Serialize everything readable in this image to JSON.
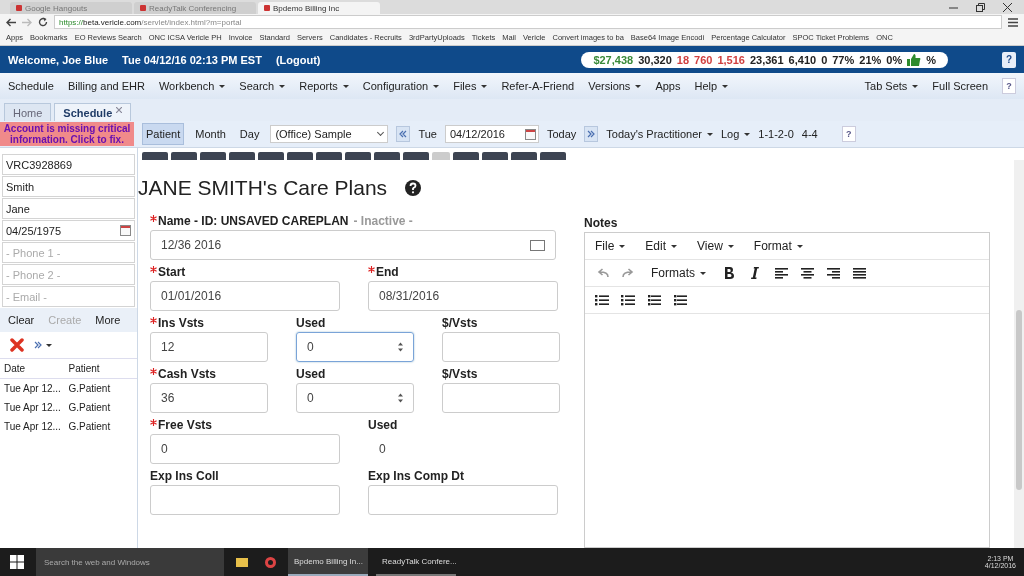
{
  "browser": {
    "tabs": [
      {
        "title": "Google Hangouts",
        "selected": false
      },
      {
        "title": "ReadyTalk Conferencing",
        "selected": false
      },
      {
        "title": "Bpdemo Billing Inc",
        "selected": true
      }
    ],
    "url_secure": "https://",
    "url_host": "beta.vericle.com",
    "url_path": "/servlet/index.html?m=portal",
    "bookmarks": [
      "Apps",
      "Bookmarks",
      "EO Reviews Search",
      "ONC ICSA Vericle PH",
      "Invoice",
      "Standard",
      "Servers",
      "Candidates - Recruits",
      "3rdPartyUploads",
      "Tickets",
      "Mail",
      "Vericle",
      "Convert images to ba",
      "Base64 Image Encodi",
      "Percentage Calculator",
      "SPOC Ticket Problems",
      "ONC"
    ]
  },
  "header": {
    "welcome": "Welcome, Joe Blue",
    "datetime": "Tue 04/12/16 02:13 PM EST",
    "logout": "(Logout)",
    "stats": [
      {
        "text": "$27,438",
        "color": "#3a8a3a"
      },
      {
        "text": "30,320",
        "color": "#222222"
      },
      {
        "text": "18",
        "color": "#d04040"
      },
      {
        "text": "760",
        "color": "#d04040"
      },
      {
        "text": "1,516",
        "color": "#d04040"
      },
      {
        "text": "23,361",
        "color": "#222222"
      },
      {
        "text": "6,410",
        "color": "#222222"
      },
      {
        "text": "0",
        "color": "#222222"
      },
      {
        "text": "77%",
        "color": "#222222"
      },
      {
        "text": "21%",
        "color": "#222222"
      },
      {
        "text": "0%",
        "color": "#222222"
      }
    ],
    "stats_suffix": "%",
    "help": "?"
  },
  "menu": {
    "items": [
      {
        "label": "Schedule",
        "dropdown": false
      },
      {
        "label": "Billing and EHR",
        "dropdown": false
      },
      {
        "label": "Workbench",
        "dropdown": true
      },
      {
        "label": "Search",
        "dropdown": true
      },
      {
        "label": "Reports",
        "dropdown": true
      },
      {
        "label": "Configuration",
        "dropdown": true
      },
      {
        "label": "Files",
        "dropdown": true
      },
      {
        "label": "Refer-A-Friend",
        "dropdown": false
      },
      {
        "label": "Versions",
        "dropdown": true
      },
      {
        "label": "Apps",
        "dropdown": false
      },
      {
        "label": "Help",
        "dropdown": true
      }
    ],
    "right_items": [
      {
        "label": "Tab Sets",
        "dropdown": true
      },
      {
        "label": "Full Screen",
        "dropdown": false
      }
    ],
    "help": "?"
  },
  "page_tabs": [
    {
      "label": "Home",
      "selected": false,
      "closable": false
    },
    {
      "label": "Schedule",
      "selected": true,
      "closable": true
    }
  ],
  "alert": "Account is missing critical information. Click to fix.",
  "toolbar": {
    "views": [
      {
        "label": "Patient",
        "selected": true
      },
      {
        "label": "Month",
        "selected": false
      },
      {
        "label": "Day",
        "selected": false
      }
    ],
    "location": "(Office) Sample",
    "day": "Tue",
    "date": "04/12/2016",
    "today": "Today",
    "practitioner": "Today's Practitioner",
    "log": "Log",
    "code_1": "1-1-2-0",
    "code_2": "4-4",
    "help": "?"
  },
  "sidebar": {
    "fields": [
      {
        "value": "VRC3928869",
        "calendar": false
      },
      {
        "value": "Smith",
        "calendar": false
      },
      {
        "value": "Jane",
        "calendar": false
      },
      {
        "value": "04/25/1975",
        "calendar": true
      },
      {
        "placeholder": "- Phone 1 -",
        "calendar": false
      },
      {
        "placeholder": "- Phone 2 -",
        "calendar": false
      },
      {
        "placeholder": "- Email -",
        "calendar": false
      }
    ],
    "actions": [
      {
        "label": "Clear",
        "disabled": false
      },
      {
        "label": "Create",
        "disabled": true
      },
      {
        "label": "More",
        "disabled": false
      }
    ],
    "columns": [
      "Date",
      "Patient"
    ],
    "rows": [
      [
        "Tue Apr 12...",
        "G.Patient"
      ],
      [
        "Tue Apr 12...",
        "G.Patient"
      ],
      [
        "Tue Apr 12...",
        "G.Patient"
      ]
    ]
  },
  "section_tabs": [
    {
      "selected": false
    },
    {
      "selected": false
    },
    {
      "selected": false
    },
    {
      "selected": false
    },
    {
      "selected": false
    },
    {
      "selected": false
    },
    {
      "selected": false
    },
    {
      "selected": false
    },
    {
      "selected": false
    },
    {
      "selected": false
    },
    {
      "selected": true
    },
    {
      "selected": false
    },
    {
      "selected": false
    },
    {
      "selected": false
    },
    {
      "selected": false
    }
  ],
  "careplan": {
    "title": "JANE SMITH's Care Plans",
    "name_label": "Name - ID: UNSAVED CAREPLAN",
    "name_required": true,
    "status": "- Inactive -",
    "name_value": "12/36 2016",
    "rows": [
      [
        {
          "label": "Start",
          "required": true,
          "kind": "text",
          "value": "01/01/2016",
          "focused": false
        },
        {
          "label": "End",
          "required": true,
          "kind": "text",
          "value": "08/31/2016",
          "focused": false
        }
      ],
      [
        {
          "label": "Ins Vsts",
          "required": true,
          "kind": "text",
          "value": "12",
          "focused": false
        },
        {
          "label": "Used",
          "required": false,
          "kind": "spinner",
          "value": "0",
          "focused": true
        },
        {
          "label": "$/Vsts",
          "required": false,
          "kind": "text",
          "focused": false
        }
      ],
      [
        {
          "label": "Cash Vsts",
          "required": true,
          "kind": "text",
          "value": "36",
          "focused": false
        },
        {
          "label": "Used",
          "required": false,
          "kind": "spinner",
          "value": "0",
          "focused": false
        },
        {
          "label": "$/Vsts",
          "required": false,
          "kind": "text",
          "focused": false
        }
      ],
      [
        {
          "label": "Free Vsts",
          "required": true,
          "kind": "text",
          "value": "0",
          "focused": false
        },
        {
          "label": "Used",
          "required": false,
          "kind": "readonly",
          "value": "0"
        }
      ],
      [
        {
          "label": "Exp Ins Coll",
          "required": false,
          "kind": "text",
          "focused": false
        },
        {
          "label": "Exp Ins Comp Dt",
          "required": false,
          "kind": "text",
          "focused": false
        }
      ]
    ]
  },
  "notes": {
    "label": "Notes",
    "menus": [
      "File",
      "Edit",
      "View",
      "Format"
    ],
    "formats": "Formats"
  },
  "taskbar": {
    "search_placeholder": "Search the web and Windows",
    "apps": [
      {
        "label": "Bpdemo Billing In...",
        "selected": true
      },
      {
        "label": "ReadyTalk Confere...",
        "selected": false
      }
    ],
    "time": "2:13 PM",
    "date": "4/12/2016"
  }
}
